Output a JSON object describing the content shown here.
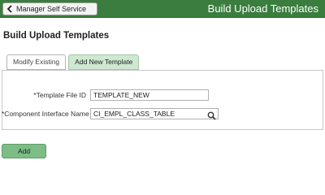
{
  "header": {
    "back_label": "Manager Self Service",
    "title": "Build Upload Templates",
    "back_icon": "chevron-left-icon",
    "bar_color": "#3a7d3e"
  },
  "page": {
    "title": "Build Upload Templates"
  },
  "tabs": [
    {
      "label": "Modify Existing",
      "active": false
    },
    {
      "label": "Add New Template",
      "active": true
    }
  ],
  "form": {
    "template_file_id": {
      "label": "*Template File ID",
      "value": "TEMPLATE_NEW"
    },
    "component_interface_name": {
      "label": "*Component Interface Name",
      "value": "CI_EMPL_CLASS_TABLE",
      "lookup_icon": "search-icon"
    }
  },
  "actions": {
    "add_label": "Add",
    "add_color": "#7dbd85"
  }
}
